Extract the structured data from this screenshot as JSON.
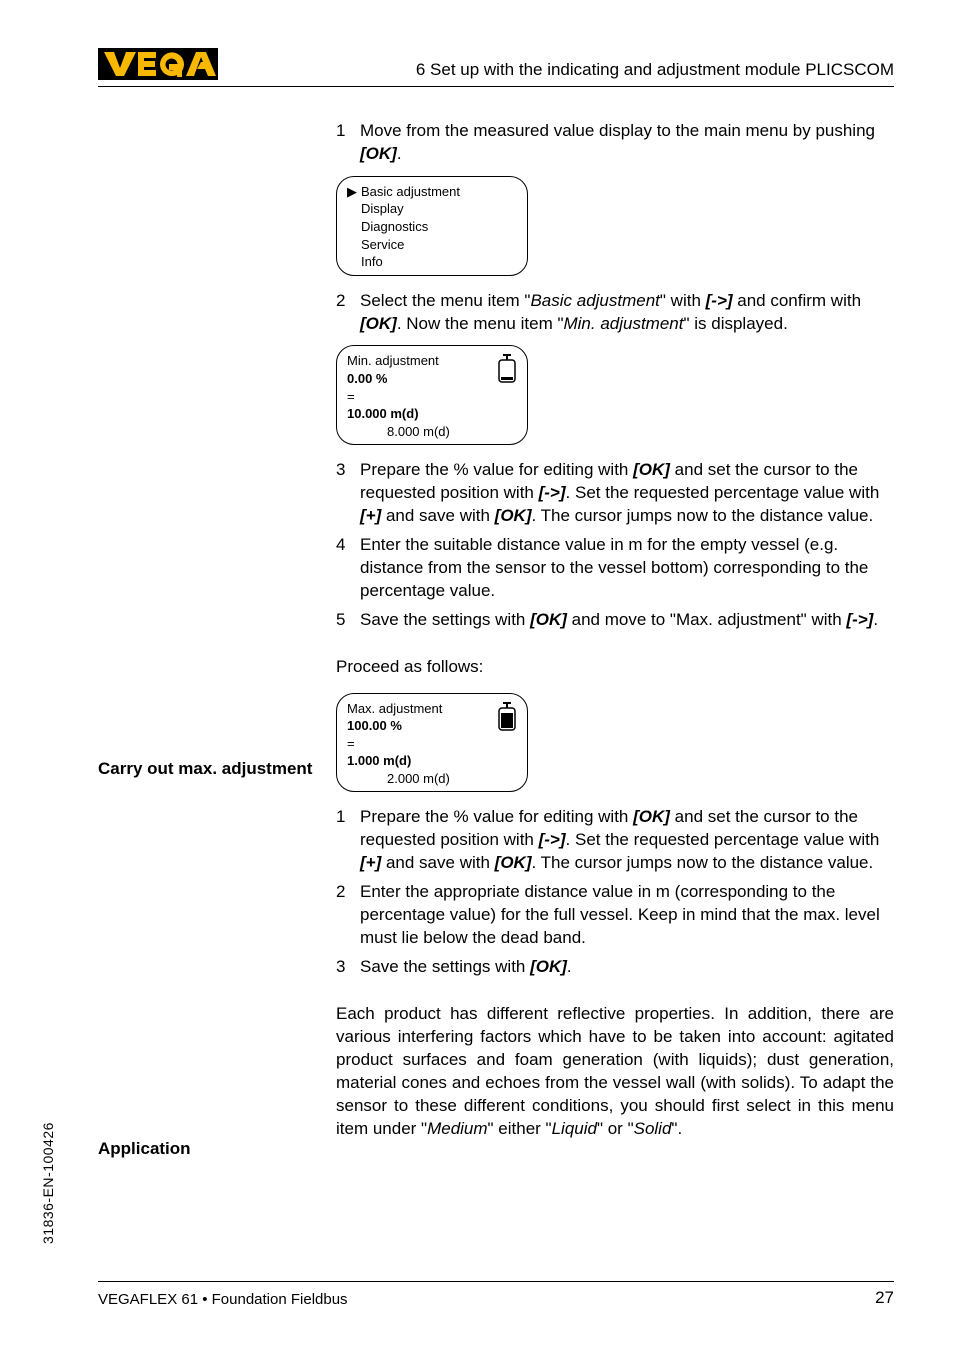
{
  "header": {
    "section": "6  Set up with the indicating and adjustment module PLICSCOM"
  },
  "steps_a": [
    {
      "n": "1",
      "body": "Move from the measured value display to the main menu by pushing ",
      "key": "[OK]",
      "tail": "."
    }
  ],
  "lcd_menu": {
    "items": [
      "Basic adjustment",
      "Display",
      "Diagnostics",
      "Service",
      "Info"
    ],
    "selected_index": 0
  },
  "steps_b": [
    {
      "n": "2",
      "parts": [
        {
          "t": "Select the menu item \""
        },
        {
          "i": "Basic adjustment"
        },
        {
          "t": "\" with "
        },
        {
          "k": "[->]"
        },
        {
          "t": " and confirm with "
        },
        {
          "k": "[OK]"
        },
        {
          "t": ". Now the menu item \""
        },
        {
          "i": "Min. adjustment"
        },
        {
          "t": "\" is displayed."
        }
      ]
    }
  ],
  "lcd_min": {
    "title": "Min. adjustment",
    "percent": "0.00 %",
    "eq": "=",
    "val": "10.000 m(d)",
    "sub": "8.000 m(d)",
    "tank": "empty"
  },
  "steps_c": [
    {
      "n": "3",
      "parts": [
        {
          "t": "Prepare the % value for editing with "
        },
        {
          "k": "[OK]"
        },
        {
          "t": " and set the cursor to the requested position with "
        },
        {
          "k": "[->]"
        },
        {
          "t": ". Set the requested percentage value with "
        },
        {
          "k": "[+]"
        },
        {
          "t": " and save with "
        },
        {
          "k": "[OK]"
        },
        {
          "t": ". The cursor jumps now to the distance value."
        }
      ]
    },
    {
      "n": "4",
      "parts": [
        {
          "t": "Enter the suitable distance value in m for the empty vessel (e.g. distance from the sensor to the vessel bottom) corresponding to the percentage value."
        }
      ]
    },
    {
      "n": "5",
      "parts": [
        {
          "t": "Save the settings with "
        },
        {
          "k": "[OK]"
        },
        {
          "t": " and move to \"Max. adjustment\" with "
        },
        {
          "k": "[->]"
        },
        {
          "t": "."
        }
      ]
    }
  ],
  "side_max": "Carry out max. adjustment",
  "proceed": "Proceed as follows:",
  "lcd_max": {
    "title": "Max. adjustment",
    "percent": "100.00 %",
    "eq": "=",
    "val": "1.000 m(d)",
    "sub": "2.000 m(d)",
    "tank": "full"
  },
  "steps_d": [
    {
      "n": "1",
      "parts": [
        {
          "t": "Prepare the % value for editing with "
        },
        {
          "k": "[OK]"
        },
        {
          "t": " and set the cursor to the requested position with "
        },
        {
          "k": "[->]"
        },
        {
          "t": ". Set the requested percentage value with "
        },
        {
          "k": "[+]"
        },
        {
          "t": " and save with "
        },
        {
          "k": "[OK]"
        },
        {
          "t": ". The cursor jumps now to the distance value."
        }
      ]
    },
    {
      "n": "2",
      "parts": [
        {
          "t": "Enter the appropriate distance value in m (corresponding to the percentage value) for the full vessel. Keep in mind that the max. level must lie below the dead band."
        }
      ]
    },
    {
      "n": "3",
      "parts": [
        {
          "t": "Save the settings with "
        },
        {
          "k": "[OK]"
        },
        {
          "t": "."
        }
      ]
    }
  ],
  "side_app": "Application",
  "app_para": {
    "parts": [
      {
        "t": "Each product has different reflective properties. In addition, there are various interfering factors which have to be taken into account: agitated product surfaces and foam generation (with liquids); dust generation, material cones and echoes from the vessel wall (with solids). To adapt the sensor to these different conditions, you should first select in this menu item under \""
      },
      {
        "i": "Medium"
      },
      {
        "t": "\" either \""
      },
      {
        "i": "Liquid"
      },
      {
        "t": "\" or \""
      },
      {
        "i": "Solid"
      },
      {
        "t": "\"."
      }
    ]
  },
  "footer": {
    "left": "VEGAFLEX 61 • Foundation Fieldbus",
    "page": "27",
    "docnum": "31836-EN-100426"
  }
}
